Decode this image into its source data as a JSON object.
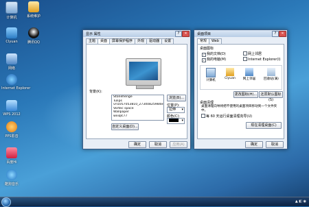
{
  "desktop": {
    "icons": [
      {
        "label": "计算机"
      },
      {
        "label": "Clyuan"
      },
      {
        "label": "网络"
      },
      {
        "label": "回收站"
      },
      {
        "label": "Internet Explorer"
      },
      {
        "label": "WPS 2012"
      },
      {
        "label": "PPS影音"
      },
      {
        "label": "迅雷 7"
      },
      {
        "label": "百度Hi"
      },
      {
        "label": "酷狗音乐"
      },
      {
        "label": "系统维护"
      },
      {
        "label": "腾讯QQ"
      }
    ]
  },
  "display_dialog": {
    "title": "显示 属性",
    "tabs": [
      "主题",
      "桌面",
      "屏幕保护程序",
      "外观",
      "驱动器",
      "设置"
    ],
    "background_label": "背景(K):",
    "background_items": [
      "Stonehenge",
      "Tulips",
      "vrl1057053810_27340825984e8b0ags=6",
      "Vortec space",
      "Wallpaper",
      "wxiqlc77"
    ],
    "browse_button": "浏览(B)...",
    "position_label": "位置(P):",
    "position_value": "拉伸",
    "color_label": "颜色(C):",
    "custom_desktop_button": "自定义桌面(D)...",
    "ok_button": "确定",
    "cancel_button": "取消",
    "apply_button": "应用(A)"
  },
  "desktop_items_dialog": {
    "title": "桌面项目",
    "tabs": [
      "常规",
      "Web"
    ],
    "desktop_icons_label": "桌面图标",
    "checkboxes": [
      {
        "label": "我的文档(D)",
        "checked": true
      },
      {
        "label": "网上邻居",
        "checked": false
      },
      {
        "label": "我的电脑(M)",
        "checked": true
      },
      {
        "label": "Internet Explorer(I)",
        "checked": false
      }
    ],
    "preview_icons": [
      "计算机",
      "Clyuan",
      "网上邻居",
      "回收站(满)"
    ],
    "change_icon_button": "更改图标(H)...",
    "restore_default_button": "还原默认图标(S)",
    "cleanup_label": "桌面清理",
    "cleanup_desc": "桌面清理向导将把不使用的桌面项目移动到一个文件夹中。",
    "cleanup_check": "每 60 天运行桌面清理向导(U)",
    "cleanup_button": "现在清理桌面(C)",
    "ok_button": "确定",
    "cancel_button": "取消"
  },
  "colors": {
    "accent": "#3a5b86",
    "desktop": "#2a78b8"
  }
}
